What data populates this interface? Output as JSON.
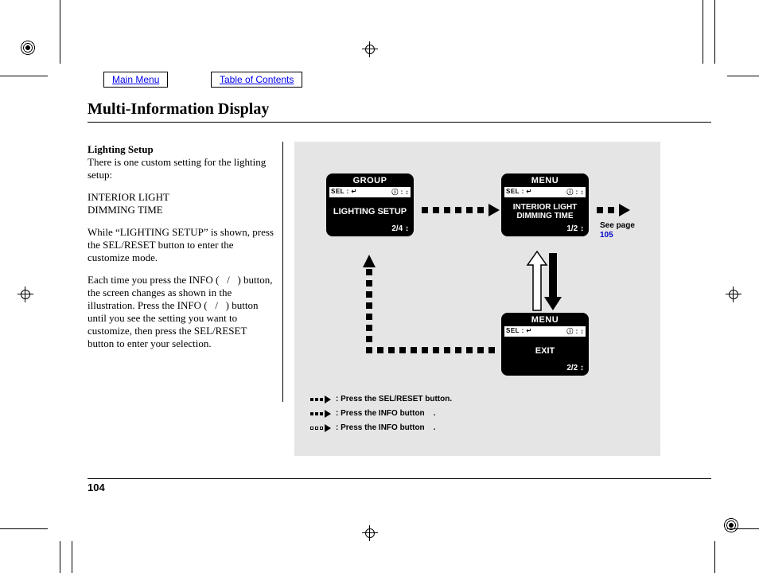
{
  "nav": {
    "main_menu": "Main Menu",
    "toc": "Table of Contents"
  },
  "header": "Multi-Information Display",
  "left": {
    "subhead": "Lighting Setup",
    "p1": "There is one custom setting for the lighting setup:",
    "p2a": "INTERIOR LIGHT",
    "p2b": "DIMMING TIME",
    "p3": "While “LIGHTING SETUP” is shown, press the SEL/RESET button to enter the customize mode.",
    "p4": "Each time you press the INFO (   /   ) button, the screen changes as shown in the illustration. Press the INFO (   /   ) button until you see the setting you want to customize, then press the SEL/RESET button to enter your selection."
  },
  "lcd1": {
    "title": "GROUP",
    "sel_left": "SEL : ↵",
    "sel_right": "ⓘ : ↕",
    "body": "LIGHTING SETUP",
    "page": "2/4 ↕"
  },
  "lcd2": {
    "title": "MENU",
    "sel_left": "SEL : ↵",
    "sel_right": "ⓘ : ↕",
    "body": "INTERIOR LIGHT DIMMING TIME",
    "page": "1/2 ↕"
  },
  "lcd3": {
    "title": "MENU",
    "sel_left": "SEL : ↵",
    "sel_right": "ⓘ : ↕",
    "body": "EXIT",
    "page": "2/2 ↕"
  },
  "seepage": {
    "label": "See page",
    "link": "105"
  },
  "legend": {
    "l1": ": Press the SEL/RESET button.",
    "l2": ": Press the INFO button    .",
    "l3": ": Press the INFO button    ."
  },
  "pagenum": "104"
}
